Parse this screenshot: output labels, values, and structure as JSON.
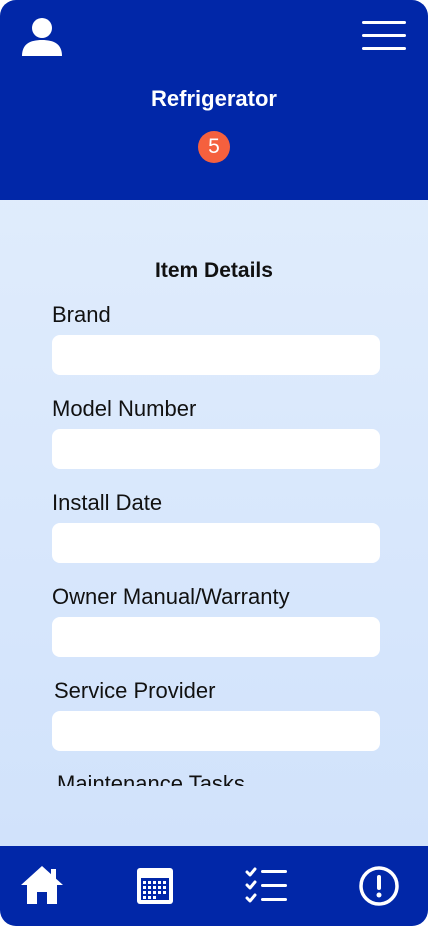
{
  "header": {
    "title": "Refrigerator",
    "badge_count": "5",
    "profile_icon": "user-icon",
    "menu_icon": "hamburger-menu-icon"
  },
  "details": {
    "section_title": "Item Details",
    "fields": [
      {
        "label": "Brand",
        "value": ""
      },
      {
        "label": "Model Number",
        "value": ""
      },
      {
        "label": "Install Date",
        "value": ""
      },
      {
        "label": "Owner Manual/Warranty",
        "value": ""
      },
      {
        "label": "Service Provider",
        "value": ""
      },
      {
        "label": "Maintenance Tasks",
        "value": ""
      }
    ]
  },
  "bottom_nav": {
    "items": [
      {
        "icon": "home-icon"
      },
      {
        "icon": "calendar-icon"
      },
      {
        "icon": "checklist-icon"
      },
      {
        "icon": "alert-icon"
      }
    ]
  },
  "colors": {
    "primary": "#0127a8",
    "badge": "#f5603e",
    "background_top": "#e4effd",
    "background_bottom": "#cfe1fb",
    "input": "#ffffff"
  }
}
